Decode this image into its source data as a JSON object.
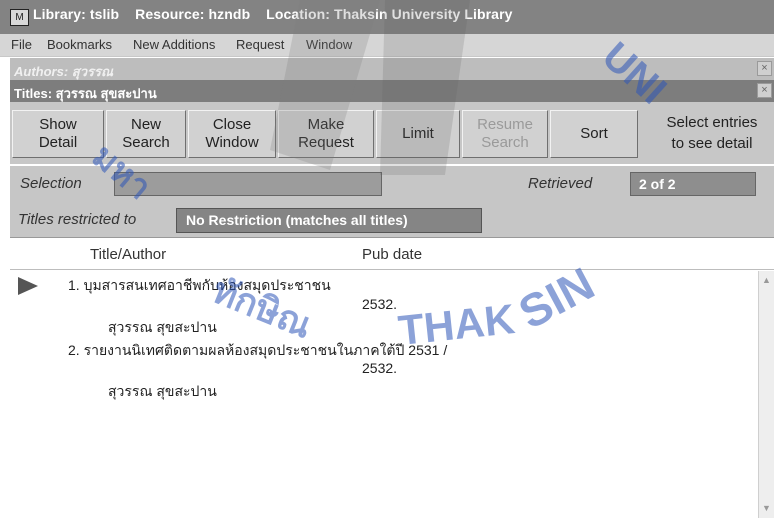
{
  "titlebar": {
    "text": "Library: tslib    Resource: hzndb    Location: Thaksin University Library",
    "icon": "library-app-icon"
  },
  "menu": {
    "file": "File",
    "bookmarks": "Bookmarks",
    "new_additions": "New Additions",
    "request": "Request",
    "window": "Window"
  },
  "authors_window": {
    "title": "Authors: สุวรรณ",
    "close": "×"
  },
  "titles_window": {
    "title": "Titles: สุวรรณ สุขสะปาน",
    "close": "×"
  },
  "toolbar": {
    "show_detail": [
      "Show",
      "Detail"
    ],
    "new_search": [
      "New",
      "Search"
    ],
    "close_window": [
      "Close",
      "Window"
    ],
    "make_request": [
      "Make",
      "Request"
    ],
    "limit": "Limit",
    "resume_search": [
      "Resume",
      "Search"
    ],
    "sort": "Sort",
    "hint": [
      "Select entries",
      "to see detail"
    ]
  },
  "selection": {
    "label": "Selection",
    "value": ""
  },
  "retrieved": {
    "label": "Retrieved",
    "value": "2 of 2"
  },
  "restriction": {
    "label": "Titles restricted to",
    "value": "No Restriction (matches all titles)"
  },
  "columns": {
    "title_author": "Title/Author",
    "pub_date": "Pub date"
  },
  "results": [
    {
      "title": "1. บุมสารสนเทศอาชีพกับห้องสมุดประชาชน",
      "date": "2532.",
      "author": "สุวรรณ สุขสะปาน"
    },
    {
      "title": "2. รายงานนิเทศติดตามผลห้องสมุดประชาชนในภาคใต้ปี 2531 /",
      "date": "2532.",
      "author": "สุวรรณ สุขสะปาน"
    }
  ],
  "watermark": {
    "text": "THAKSIN UNIVERSITY"
  },
  "colors": {
    "titlebar": "#838383",
    "toolbar": "#c7c7c7",
    "field_dark": "#858585"
  }
}
